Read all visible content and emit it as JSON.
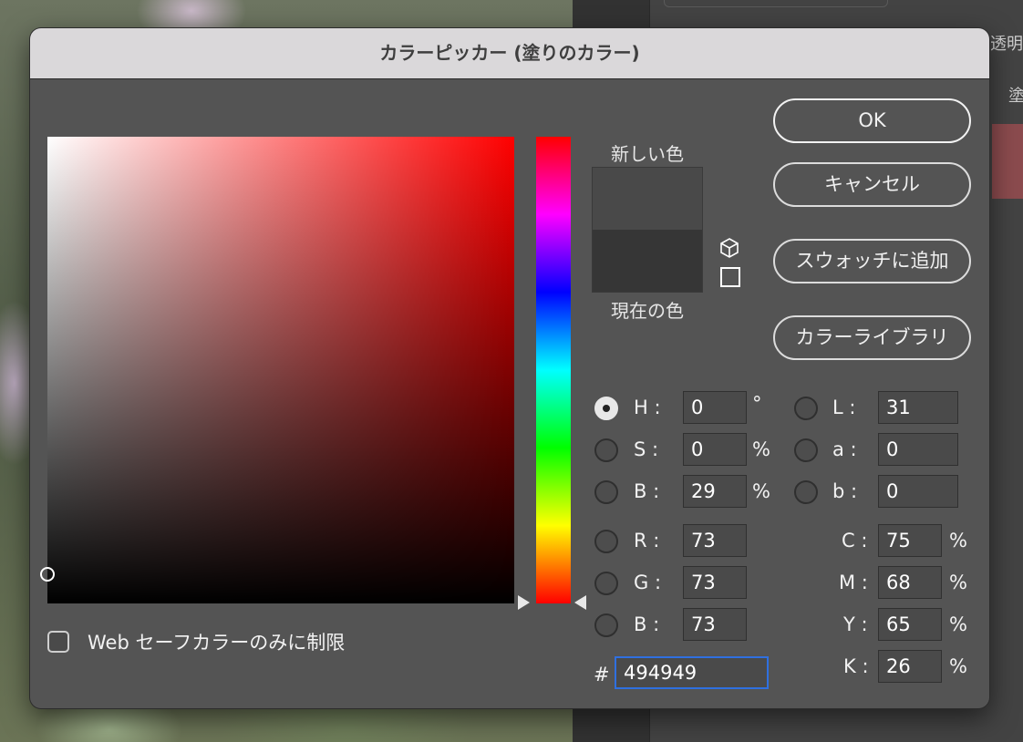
{
  "background": {
    "panel_label_1": "透明",
    "panel_label_2": "塗"
  },
  "dialog": {
    "title": "カラーピッカー (塗りのカラー)",
    "new_color_label": "新しい色",
    "current_color_label": "現在の色",
    "new_color": "#494949",
    "current_color": "#363636",
    "buttons": {
      "ok": "OK",
      "cancel": "キャンセル",
      "add_swatch": "スウォッチに追加",
      "color_library": "カラーライブラリ"
    },
    "fields": {
      "H": {
        "label": "H :",
        "value": "0",
        "unit": "°"
      },
      "S": {
        "label": "S :",
        "value": "0",
        "unit": "%"
      },
      "Bv": {
        "label": "B :",
        "value": "29",
        "unit": "%"
      },
      "R": {
        "label": "R :",
        "value": "73"
      },
      "G": {
        "label": "G :",
        "value": "73"
      },
      "Bl": {
        "label": "B :",
        "value": "73"
      },
      "L": {
        "label": "L :",
        "value": "31"
      },
      "a": {
        "label": "a :",
        "value": "0"
      },
      "b": {
        "label": "b :",
        "value": "0"
      },
      "C": {
        "label": "C :",
        "value": "75",
        "unit": "%"
      },
      "M": {
        "label": "M :",
        "value": "68",
        "unit": "%"
      },
      "Y": {
        "label": "Y :",
        "value": "65",
        "unit": "%"
      },
      "K": {
        "label": "K :",
        "value": "26",
        "unit": "%"
      }
    },
    "hex_prefix": "#",
    "hex_value": "494949",
    "selected_mode": "H",
    "websafe_label": "Web セーフカラーのみに制限",
    "websafe_checked": false,
    "accent_color": "#2f70e0"
  }
}
